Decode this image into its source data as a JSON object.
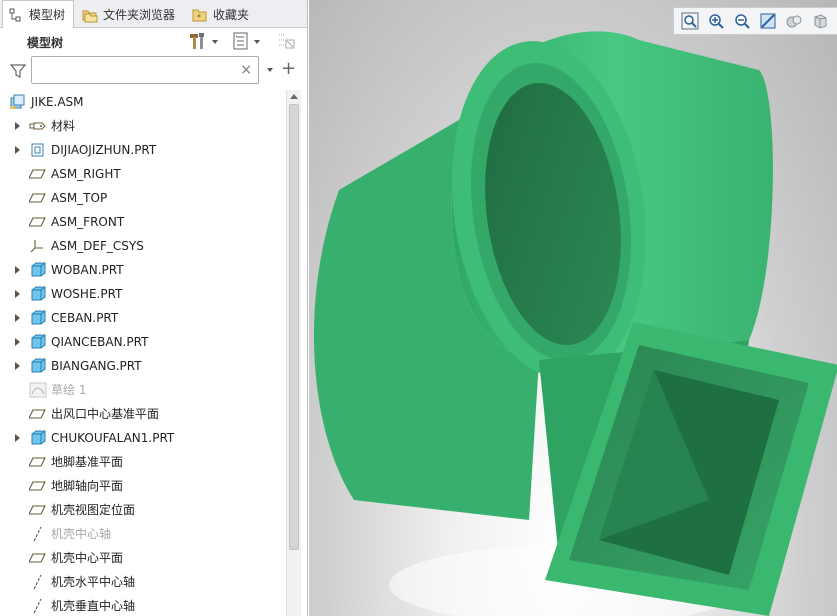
{
  "tabs": [
    {
      "label": "模型树",
      "icon": "model-tree-icon",
      "active": true
    },
    {
      "label": "文件夹浏览器",
      "icon": "folder-browser-icon",
      "active": false
    },
    {
      "label": "收藏夹",
      "icon": "favorites-icon",
      "active": false
    }
  ],
  "panel": {
    "title": "模型树",
    "settings_icon": "tree-settings-icon",
    "show_icon": "tree-show-icon",
    "columns_icon": "tree-columns-icon"
  },
  "search": {
    "value": "",
    "placeholder": "",
    "clear_label": "×",
    "add_label": "+"
  },
  "tree": {
    "root": {
      "label": "JIKE.ASM",
      "icon": "assembly-icon"
    },
    "items": [
      {
        "label": "材料",
        "icon": "material-icon",
        "expandable": true,
        "dim": false
      },
      {
        "label": "DIJIAOJIZHUN.PRT",
        "icon": "part-skeleton-icon",
        "expandable": true,
        "dim": false
      },
      {
        "label": "ASM_RIGHT",
        "icon": "datum-plane-icon",
        "expandable": false,
        "dim": false
      },
      {
        "label": "ASM_TOP",
        "icon": "datum-plane-icon",
        "expandable": false,
        "dim": false
      },
      {
        "label": "ASM_FRONT",
        "icon": "datum-plane-icon",
        "expandable": false,
        "dim": false
      },
      {
        "label": "ASM_DEF_CSYS",
        "icon": "csys-icon",
        "expandable": false,
        "dim": false
      },
      {
        "label": "WOBAN.PRT",
        "icon": "part-icon",
        "expandable": true,
        "dim": false
      },
      {
        "label": "WOSHE.PRT",
        "icon": "part-icon",
        "expandable": true,
        "dim": false
      },
      {
        "label": "CEBAN.PRT",
        "icon": "part-icon",
        "expandable": true,
        "dim": false
      },
      {
        "label": "QIANCEBAN.PRT",
        "icon": "part-icon",
        "expandable": true,
        "dim": false
      },
      {
        "label": "BIANGANG.PRT",
        "icon": "part-icon",
        "expandable": true,
        "dim": false
      },
      {
        "label": "草绘 1",
        "icon": "sketch-icon",
        "expandable": false,
        "dim": true
      },
      {
        "label": "出风口中心基准平面",
        "icon": "datum-plane-icon",
        "expandable": false,
        "dim": false
      },
      {
        "label": "CHUKOUFALAN1.PRT",
        "icon": "part-icon",
        "expandable": true,
        "dim": false
      },
      {
        "label": "地脚基准平面",
        "icon": "datum-plane-icon",
        "expandable": false,
        "dim": false
      },
      {
        "label": "地脚轴向平面",
        "icon": "datum-plane-icon",
        "expandable": false,
        "dim": false
      },
      {
        "label": "机壳视图定位面",
        "icon": "datum-plane-icon",
        "expandable": false,
        "dim": false
      },
      {
        "label": "机壳中心轴",
        "icon": "datum-axis-icon",
        "expandable": false,
        "dim": true
      },
      {
        "label": "机壳中心平面",
        "icon": "datum-plane-icon",
        "expandable": false,
        "dim": false
      },
      {
        "label": "机壳水平中心轴",
        "icon": "datum-axis-icon",
        "expandable": false,
        "dim": false
      },
      {
        "label": "机壳垂直中心轴",
        "icon": "datum-axis-icon",
        "expandable": false,
        "dim": false
      }
    ]
  },
  "view_toolbar": [
    "zoom-fit-icon",
    "zoom-in-icon",
    "zoom-out-icon",
    "repaint-icon",
    "view-manager-icon",
    "display-style-icon"
  ],
  "colors": {
    "model_green": "#3fbf75",
    "model_green_dark": "#2f9a5c",
    "part_blue": "#6cc6ee",
    "datum_icon": "#6b5a3a"
  }
}
